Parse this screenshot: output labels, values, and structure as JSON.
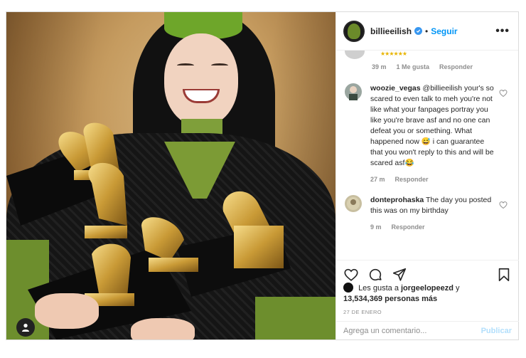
{
  "colors": {
    "accent": "#0095f6",
    "verified": "#3897f0",
    "muted_text": "#8e8e8e",
    "publish_disabled": "#b2dffc",
    "border": "#dbdbdb"
  },
  "header": {
    "username": "billieeilish",
    "separator": "•",
    "follow_label": "Seguir",
    "more_label": "•••",
    "icons": [
      "avatar",
      "verified-badge-icon",
      "more-options-icon"
    ]
  },
  "previous_comment": {
    "stars": "★★★★★★",
    "time": "39 m",
    "likes": "1 Me gusta",
    "reply_label": "Responder"
  },
  "comments": [
    {
      "username": "woozie_vegas",
      "text": "@billieeilish your's so scared to even talk to meh you're not like what your fanpages portray you like you're brave asf and no one can defeat you or something. What happened now 😅  i can guarantee that you won't reply to this and will be scared asf😂",
      "time": "27 m",
      "reply_label": "Responder",
      "avatar_color": "#9aa6a0"
    },
    {
      "username": "donteprohaska",
      "text": "The day you posted this was on my birthday",
      "time": "9 m",
      "reply_label": "Responder",
      "avatar_color": "#c8bfa0"
    }
  ],
  "actions": {
    "icons": [
      "heart-icon",
      "comment-icon",
      "share-icon",
      "bookmark-icon"
    ]
  },
  "likes": {
    "prefix": "Les gusta a",
    "user": "jorgeelopeezd",
    "connector": "y",
    "count": "13,534,369 personas más"
  },
  "date": "27 DE ENERO",
  "comment_box": {
    "placeholder": "Agrega un comentario...",
    "publish_label": "Publicar"
  },
  "photo": {
    "tag_icon": "user-tag-icon"
  }
}
